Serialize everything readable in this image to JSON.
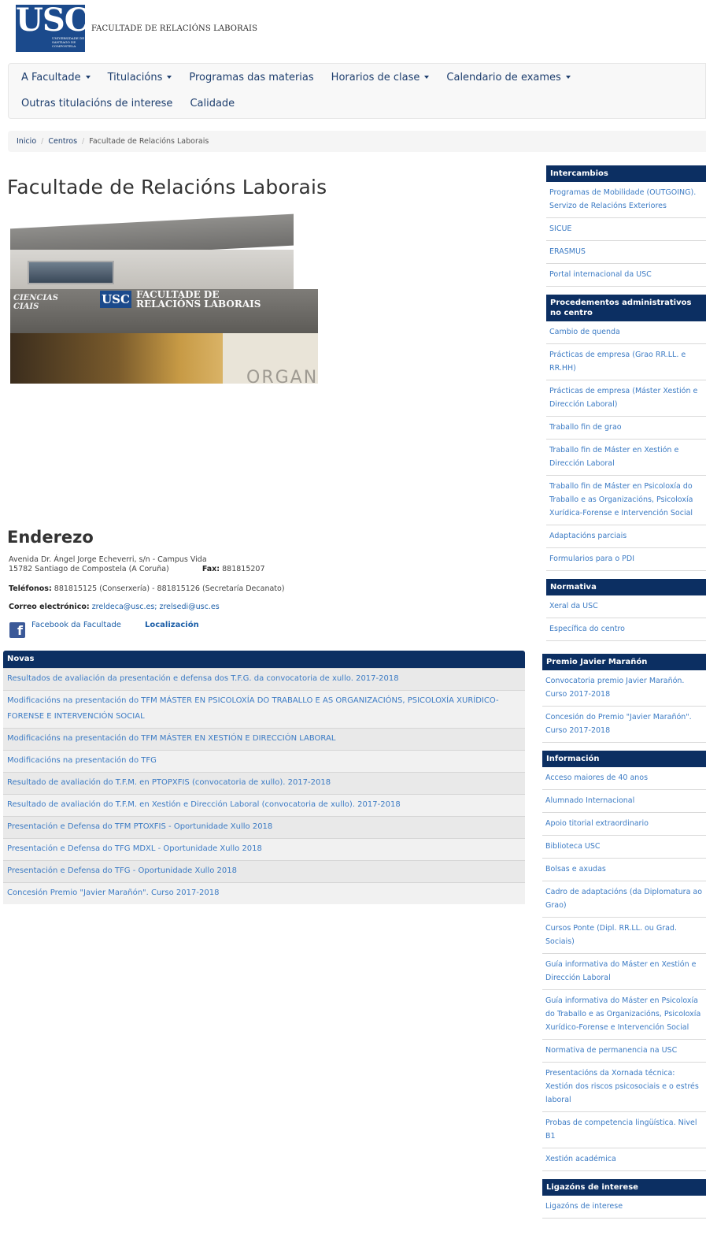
{
  "header": {
    "logo_text": "USC",
    "logo_small": "UNIVERSIDADE DE SANTIAGO DE COMPOSTELA",
    "faculty_name": "FACULTADE DE RELACIÓNS LABORAIS"
  },
  "nav": {
    "row1": [
      {
        "label": "A Facultade",
        "dropdown": true
      },
      {
        "label": "Titulacións",
        "dropdown": true
      },
      {
        "label": "Programas das materias",
        "dropdown": false
      },
      {
        "label": "Horarios de clase",
        "dropdown": true
      },
      {
        "label": "Calendario de exames",
        "dropdown": true
      }
    ],
    "row2": [
      {
        "label": "Outras titulacións de interese"
      },
      {
        "label": "Calidade"
      }
    ]
  },
  "breadcrumb": [
    "Inicio",
    "Centros",
    "Facultade de Relacións Laborais"
  ],
  "main": {
    "title": "Facultade de Relacións Laborais",
    "hero_text": {
      "left": "CIENCIAS\nCIAIS",
      "usc": "USC",
      "sign": "FACULTADE DE\nRELACIÓNS LABORAIS",
      "graffiti": "ORGANÍZ"
    },
    "address_heading": "Enderezo",
    "address_line1": "Avenida Dr. Ángel Jorge Echeverri, s/n   -   Campus Vida",
    "address_line2": "15782 Santiago de Compostela  (A Coruña)",
    "fax_label": "Fax:",
    "fax_value": "881815207",
    "phones_label": "Teléfonos:",
    "phones_value": "881815125 (Conserxería)  - 881815126 (Secretaría Decanato)",
    "email_label": "Correo electrónico:",
    "email_value": "zreldeca@usc.es; zrelsedi@usc.es",
    "facebook_label": "Facebook da Facultade",
    "location_label": "Localización"
  },
  "novas": {
    "heading": "Novas",
    "items": [
      "Resultados de avaliación da presentación e defensa dos T.F.G. da convocatoria de xullo. 2017-2018",
      "Modificacións na presentación do TFM MÁSTER EN PSICOLOXÍA DO TRABALLO E AS ORGANIZACIÓNS, PSICOLOXÍA XURÍDICO-FORENSE E INTERVENCIÓN SOCIAL",
      "Modificacións na presentación do TFM MÁSTER EN XESTIÓN E DIRECCIÓN LABORAL",
      "Modificacións na presentación do TFG",
      "Resultado de avaliación do T.F.M. en PTOPXFIS (convocatoria de xullo). 2017-2018",
      "Resultado de avaliación do T.F.M. en Xestión e Dirección Laboral (convocatoria de xullo). 2017-2018",
      "Presentación e Defensa do TFM PTOXFIS - Oportunidade Xullo 2018",
      "Presentación e Defensa do TFG MDXL - Oportunidade Xullo 2018",
      "Presentación e Defensa do TFG - Oportunidade Xullo 2018",
      "Concesión Premio \"Javier Marañón\". Curso 2017-2018"
    ]
  },
  "sidebar_top": [
    {
      "heading": "Intercambios",
      "items": [
        "Programas de Mobilidade (OUTGOING). Servizo de Relacións Exteriores",
        "SICUE",
        "ERASMUS",
        "Portal internacional da USC"
      ]
    },
    {
      "heading": "Procedementos administrativos no centro",
      "items": [
        "Cambio de quenda",
        "Prácticas de empresa (Grao RR.LL. e RR.HH)",
        "Prácticas de empresa (Máster Xestión e Dirección Laboral)",
        "Traballo fin de grao",
        "Traballo fin de Máster en Xestión e Dirección Laboral",
        "Traballo fin de Máster en Psicoloxía do Traballo e as Organizacións, Psicoloxía Xurídica-Forense e Intervención Social",
        "Adaptacións parciais",
        "Formularios para o PDI"
      ]
    },
    {
      "heading": "Normativa",
      "items": [
        "Xeral da USC",
        "Específica do centro"
      ]
    }
  ],
  "sidebar_bottom": [
    {
      "heading": "Premio Javier Marañón",
      "items": [
        "Convocatoria premio Javier Marañón. Curso 2017-2018",
        "Concesión do Premio \"Javier Marañón\". Curso 2017-2018"
      ]
    },
    {
      "heading": "Información",
      "items": [
        "Acceso maiores de 40 anos",
        "Alumnado Internacional",
        "Apoio titorial extraordinario",
        "Biblioteca USC",
        "Bolsas e axudas",
        "Cadro de adaptacións (da Diplomatura ao Grao)",
        "Cursos Ponte (Dipl. RR.LL. ou Grad. Sociais)",
        "Guía informativa do Máster en Xestión e Dirección Laboral",
        "Guía informativa do Máster en Psicoloxía do Traballo e as Organizacións, Psicoloxía Xurídico-Forense e Intervención Social",
        "Normativa de permanencia na USC",
        "Presentacións da Xornada técnica: Xestión dos riscos psicosociais e o estrés laboral",
        "Probas de competencia lingüística. Nivel B1",
        "Xestión académica"
      ]
    },
    {
      "heading": "Ligazóns de interese",
      "items": [
        "Ligazóns de interese"
      ]
    }
  ],
  "colors": {
    "brand": "#1b4a8c",
    "panel_header": "#0c2f62",
    "link": "#3c7bc4",
    "nav_text": "#1d3e6e"
  },
  "icons": {
    "facebook": "facebook-icon",
    "caret": "caret-down-icon"
  }
}
